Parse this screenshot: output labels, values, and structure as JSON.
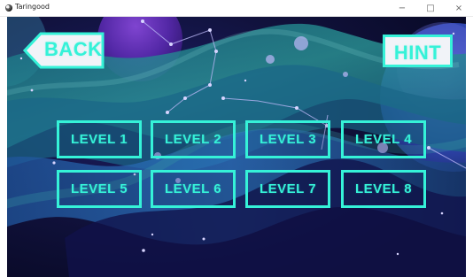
{
  "window": {
    "title": "Taringood",
    "controls": {
      "minimize": "−",
      "maximize": "□",
      "close": "×"
    },
    "icon": "app-icon"
  },
  "game": {
    "colors": {
      "accent": "#35f2d8",
      "background": "#11123b",
      "hint_fill": "#f1f3f8"
    },
    "navigation": {
      "back_label": "BACK",
      "hint_label": "HINT"
    },
    "levels": [
      {
        "label": "LEVEL 1"
      },
      {
        "label": "LEVEL 2"
      },
      {
        "label": "LEVEL 3"
      },
      {
        "label": "LEVEL 4"
      },
      {
        "label": "LEVEL 5"
      },
      {
        "label": "LEVEL 6"
      },
      {
        "label": "LEVEL 7"
      },
      {
        "label": "LEVEL 8"
      }
    ]
  }
}
